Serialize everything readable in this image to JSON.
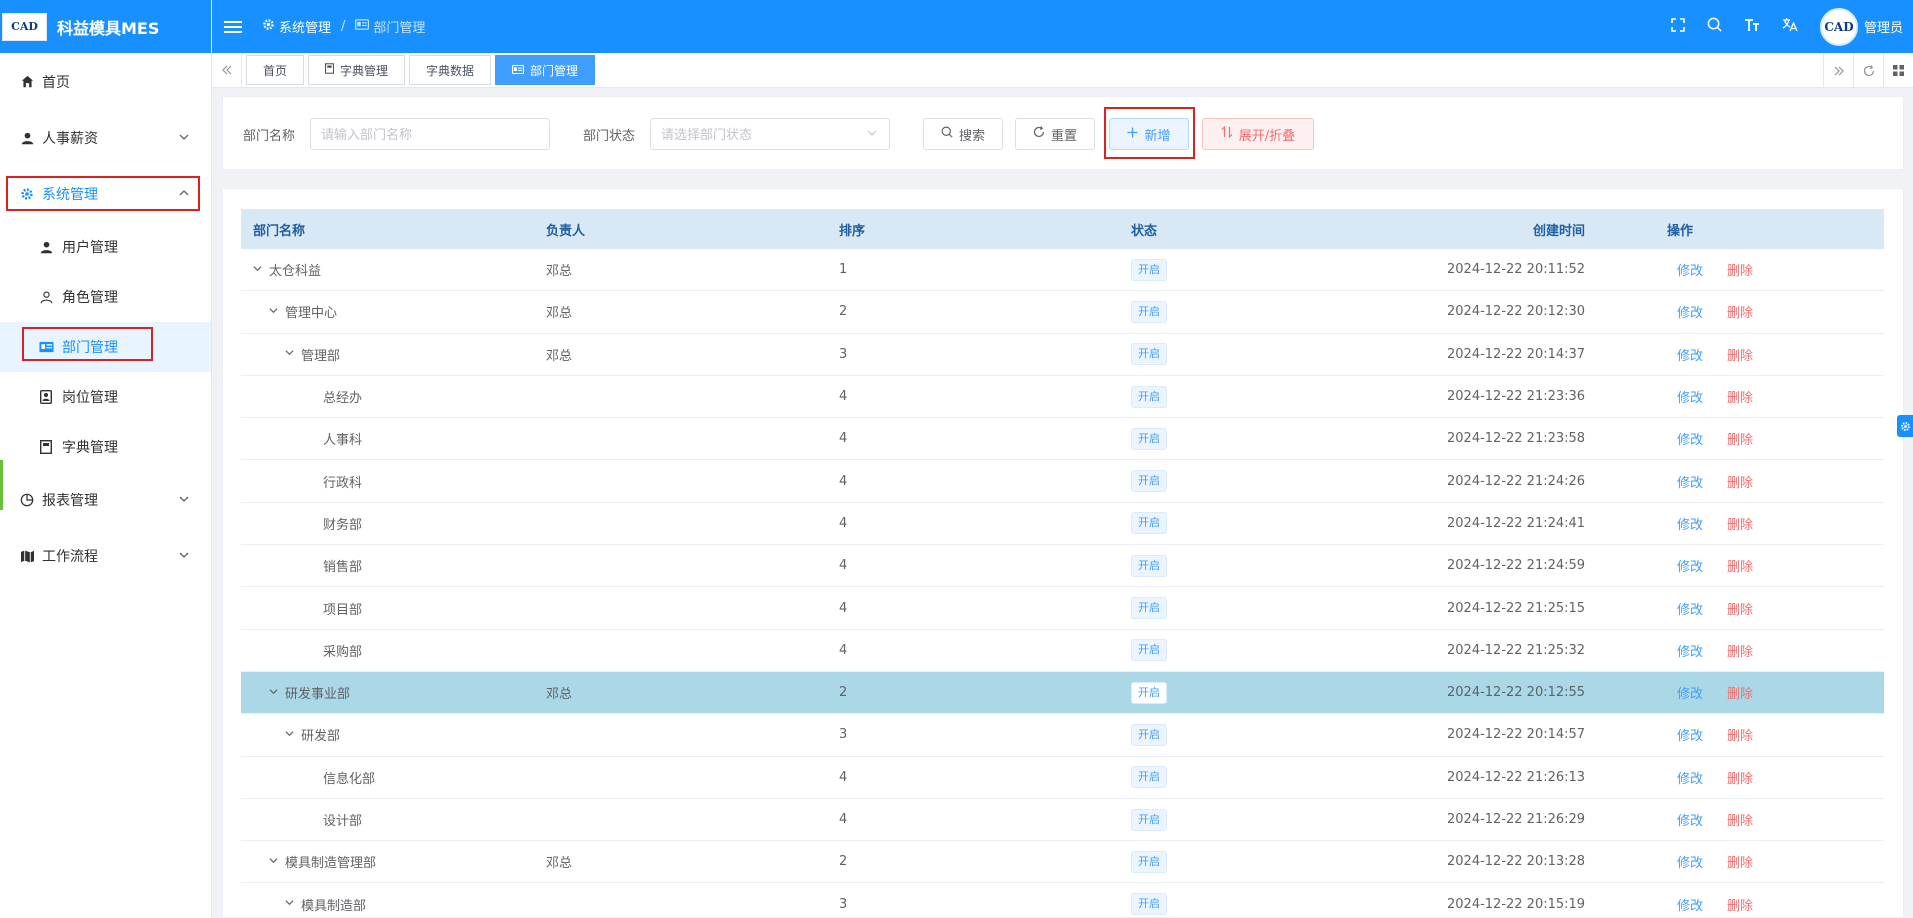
{
  "app": {
    "title": "科益模具MES",
    "logo_text": "CAD"
  },
  "sidebar": {
    "items": [
      {
        "label": "首页",
        "icon": "home-icon"
      },
      {
        "label": "人事薪资",
        "icon": "user-icon"
      },
      {
        "label": "系统管理",
        "icon": "gear-icon"
      },
      {
        "label": "报表管理",
        "icon": "pie-chart-icon"
      },
      {
        "label": "工作流程",
        "icon": "map-icon"
      }
    ],
    "sub_items": [
      {
        "label": "用户管理",
        "icon": "user-icon"
      },
      {
        "label": "角色管理",
        "icon": "user-outline-icon"
      },
      {
        "label": "部门管理",
        "icon": "id-card-icon"
      },
      {
        "label": "岗位管理",
        "icon": "post-icon"
      },
      {
        "label": "字典管理",
        "icon": "book-icon"
      }
    ]
  },
  "header": {
    "breadcrumb": [
      "系统管理",
      "部门管理"
    ],
    "user_name": "管理员",
    "avatar_text": "CAD"
  },
  "tabs": [
    {
      "label": "首页"
    },
    {
      "label": "字典管理"
    },
    {
      "label": "字典数据"
    },
    {
      "label": "部门管理"
    }
  ],
  "search": {
    "dept_name_label": "部门名称",
    "dept_name_placeholder": "请输入部门名称",
    "dept_status_label": "部门状态",
    "dept_status_placeholder": "请选择部门状态",
    "search_btn": "搜索",
    "reset_btn": "重置",
    "add_btn": "新增",
    "expand_btn": "展开/折叠"
  },
  "table": {
    "columns": [
      "部门名称",
      "负责人",
      "排序",
      "状态",
      "创建时间",
      "操作"
    ],
    "edit_label": "修改",
    "delete_label": "删除",
    "rows": [
      {
        "name": "太仓科益",
        "owner": "邓总",
        "sort": "1",
        "status": "开启",
        "time": "2024-12-22 20:11:52",
        "level": 0,
        "caret": true
      },
      {
        "name": "管理中心",
        "owner": "邓总",
        "sort": "2",
        "status": "开启",
        "time": "2024-12-22 20:12:30",
        "level": 1,
        "caret": true
      },
      {
        "name": "管理部",
        "owner": "邓总",
        "sort": "3",
        "status": "开启",
        "time": "2024-12-22 20:14:37",
        "level": 2,
        "caret": true
      },
      {
        "name": "总经办",
        "owner": "",
        "sort": "4",
        "status": "开启",
        "time": "2024-12-22 21:23:36",
        "level": 3,
        "caret": false
      },
      {
        "name": "人事科",
        "owner": "",
        "sort": "4",
        "status": "开启",
        "time": "2024-12-22 21:23:58",
        "level": 3,
        "caret": false
      },
      {
        "name": "行政科",
        "owner": "",
        "sort": "4",
        "status": "开启",
        "time": "2024-12-22 21:24:26",
        "level": 3,
        "caret": false
      },
      {
        "name": "财务部",
        "owner": "",
        "sort": "4",
        "status": "开启",
        "time": "2024-12-22 21:24:41",
        "level": 3,
        "caret": false
      },
      {
        "name": "销售部",
        "owner": "",
        "sort": "4",
        "status": "开启",
        "time": "2024-12-22 21:24:59",
        "level": 3,
        "caret": false
      },
      {
        "name": "项目部",
        "owner": "",
        "sort": "4",
        "status": "开启",
        "time": "2024-12-22 21:25:15",
        "level": 3,
        "caret": false
      },
      {
        "name": "采购部",
        "owner": "",
        "sort": "4",
        "status": "开启",
        "time": "2024-12-22 21:25:32",
        "level": 3,
        "caret": false
      },
      {
        "name": "研发事业部",
        "owner": "邓总",
        "sort": "2",
        "status": "开启",
        "time": "2024-12-22 20:12:55",
        "level": 1,
        "caret": true,
        "highlight": true
      },
      {
        "name": "研发部",
        "owner": "",
        "sort": "3",
        "status": "开启",
        "time": "2024-12-22 20:14:57",
        "level": 2,
        "caret": true
      },
      {
        "name": "信息化部",
        "owner": "",
        "sort": "4",
        "status": "开启",
        "time": "2024-12-22 21:26:13",
        "level": 3,
        "caret": false
      },
      {
        "name": "设计部",
        "owner": "",
        "sort": "4",
        "status": "开启",
        "time": "2024-12-22 21:26:29",
        "level": 3,
        "caret": false
      },
      {
        "name": "模具制造管理部",
        "owner": "邓总",
        "sort": "2",
        "status": "开启",
        "time": "2024-12-22 20:13:28",
        "level": 1,
        "caret": true
      },
      {
        "name": "模具制造部",
        "owner": "",
        "sort": "3",
        "status": "开启",
        "time": "2024-12-22 20:15:19",
        "level": 2,
        "caret": true
      }
    ]
  },
  "colors": {
    "primary": "#1890ff",
    "danger": "#f56c6c",
    "highlight_row": "#abd8e6",
    "annotation": "#e02020"
  }
}
